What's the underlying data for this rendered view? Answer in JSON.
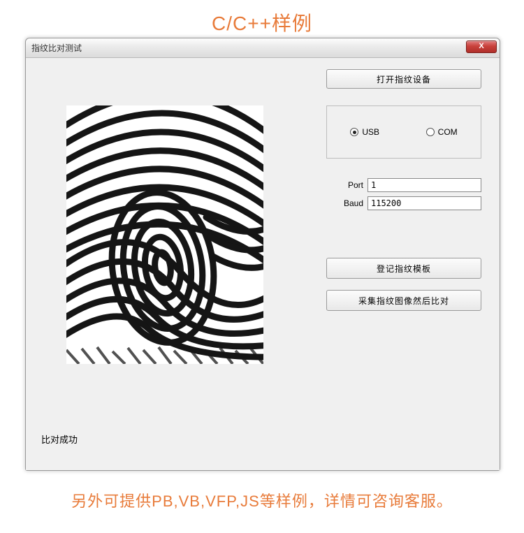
{
  "page": {
    "title": "C/C++样例",
    "footer_note": "另外可提供PB,VB,VFP,JS等样例，详情可咨询客服。"
  },
  "window": {
    "title": "指纹比对测试",
    "close_label": "X"
  },
  "buttons": {
    "open_device": "打开指纹设备",
    "register_template": "登记指纹模板",
    "capture_and_compare": "采集指纹图像然后比对"
  },
  "connection": {
    "radio_usb": "USB",
    "radio_com": "COM",
    "selected": "USB"
  },
  "fields": {
    "port_label": "Port",
    "port_value": "1",
    "baud_label": "Baud",
    "baud_value": "115200"
  },
  "status": {
    "message": "比对成功"
  },
  "fingerprint": {
    "alt": "fingerprint-scan-image"
  }
}
